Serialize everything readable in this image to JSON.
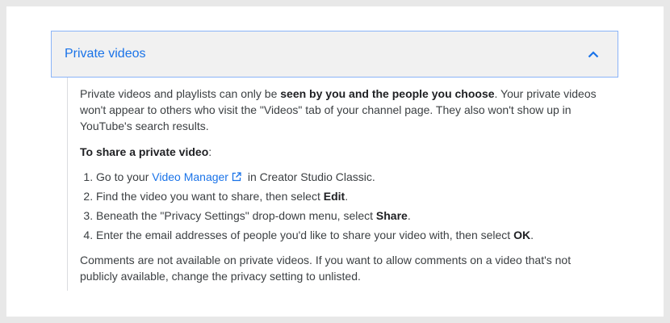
{
  "accordion": {
    "title": "Private videos",
    "expanded": true,
    "chevron_icon": "chevron-up-icon",
    "accent_color": "#1a73e8",
    "border_color": "#8ab4f8"
  },
  "content": {
    "intro": {
      "text_before": "Private videos and playlists can only be ",
      "bold": "seen by you and the people you choose",
      "text_after": ". Your private videos won't appear to others who visit the \"Videos\" tab of your channel page. They also won't show up in YouTube's search results."
    },
    "subheading": {
      "bold": "To share a private video",
      "suffix": ":"
    },
    "steps": [
      {
        "before": "Go to your ",
        "link": "Video Manager",
        "link_icon": "external-link-icon",
        "after": " in Creator Studio Classic."
      },
      {
        "before": "Find the video you want to share, then select ",
        "bold": "Edit",
        "after": "."
      },
      {
        "before": "Beneath the \"Privacy Settings\" drop-down menu, select ",
        "bold": "Share",
        "after": "."
      },
      {
        "before": "Enter the email addresses of people you'd like to share your video with, then select ",
        "bold": "OK",
        "after": "."
      }
    ],
    "footer_note": "Comments are not available on private videos. If you want to allow comments on a video that's not publicly available, change the privacy setting to unlisted."
  }
}
